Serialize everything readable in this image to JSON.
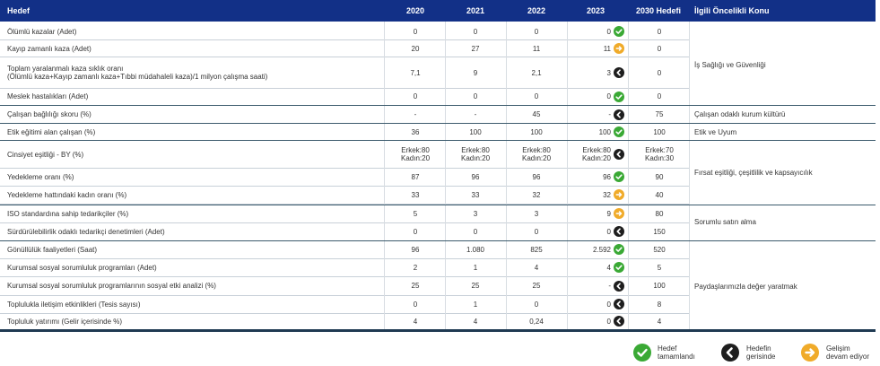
{
  "header": {
    "hedef": "Hedef",
    "y2020": "2020",
    "y2021": "2021",
    "y2022": "2022",
    "y2023": "2023",
    "target": "2030 Hedefi",
    "konu": "İlgili Öncelikli Konu"
  },
  "rows": [
    {
      "label": "Ölümlü kazalar (Adet)",
      "v2020": "0",
      "v2021": "0",
      "v2022": "0",
      "v2023": "0",
      "status": "green",
      "target": "0"
    },
    {
      "label": "Kayıp zamanlı kaza (Adet)",
      "v2020": "20",
      "v2021": "27",
      "v2022": "11",
      "v2023": "11",
      "status": "orange",
      "target": "0"
    },
    {
      "label": "Toplam yaralanmalı kaza sıklık oranı",
      "label2": "(Ölümlü kaza+Kayıp zamanlı kaza+Tıbbi müdahaleli kaza)/1 milyon çalışma saati)",
      "v2020": "7,1",
      "v2021": "9",
      "v2022": "2,1",
      "v2023": "3",
      "status": "black",
      "target": "0"
    },
    {
      "label": "Meslek hastalıkları (Adet)",
      "v2020": "0",
      "v2021": "0",
      "v2022": "0",
      "v2023": "0",
      "status": "green",
      "target": "0"
    },
    {
      "label": "Çalışan bağlılığı skoru (%)",
      "v2020": "-",
      "v2021": "-",
      "v2022": "45",
      "v2023": "-",
      "status": "black",
      "target": "75"
    },
    {
      "label": "Etik eğitimi alan çalışan (%)",
      "v2020": "36",
      "v2021": "100",
      "v2022": "100",
      "v2023": "100",
      "status": "green",
      "target": "100"
    },
    {
      "label": "Cinsiyet eşitliği - BY (%)",
      "v2020": "Erkek:80",
      "v2020b": "Kadın:20",
      "v2021": "Erkek:80",
      "v2021b": "Kadın:20",
      "v2022": "Erkek:80",
      "v2022b": "Kadın:20",
      "v2023": "Erkek:80",
      "v2023b": "Kadın:20",
      "status": "black",
      "target": "Erkek:70",
      "targetb": "Kadın:30"
    },
    {
      "label": "Yedekleme oranı (%)",
      "v2020": "87",
      "v2021": "96",
      "v2022": "96",
      "v2023": "96",
      "status": "green",
      "target": "90"
    },
    {
      "label": "Yedekleme hattındaki kadın oranı (%)",
      "v2020": "33",
      "v2021": "33",
      "v2022": "32",
      "v2023": "32",
      "status": "orange",
      "target": "40"
    },
    {
      "label": "ISO standardına sahip tedarikçiler (%)",
      "v2020": "5",
      "v2021": "3",
      "v2022": "3",
      "v2023": "9",
      "status": "orange",
      "target": "80"
    },
    {
      "label": "Sürdürülebilirlik odaklı tedarikçi denetimleri (Adet)",
      "v2020": "0",
      "v2021": "0",
      "v2022": "0",
      "v2023": "0",
      "status": "black",
      "target": "150"
    },
    {
      "label": "Gönüllülük faaliyetleri (Saat)",
      "v2020": "96",
      "v2021": "1.080",
      "v2022": "825",
      "v2023": "2.592",
      "status": "green",
      "target": "520"
    },
    {
      "label": "Kurumsal sosyal sorumluluk programları (Adet)",
      "v2020": "2",
      "v2021": "1",
      "v2022": "4",
      "v2023": "4",
      "status": "green",
      "target": "5"
    },
    {
      "label": "Kurumsal sosyal sorumluluk programlarının sosyal etki analizi (%)",
      "v2020": "25",
      "v2021": "25",
      "v2022": "25",
      "v2023": "-",
      "status": "black",
      "target": "100"
    },
    {
      "label": "Toplulukla iletişim etkinlikleri (Tesis sayısı)",
      "v2020": "0",
      "v2021": "1",
      "v2022": "0",
      "v2023": "0",
      "status": "black",
      "target": "8"
    },
    {
      "label": "Topluluk yatırımı (Gelir içerisinde %)",
      "v2020": "4",
      "v2021": "4",
      "v2022": "0,24",
      "v2023": "0",
      "status": "black",
      "target": "4"
    }
  ],
  "groups": {
    "isg": "İş Sağlığı ve Güvenliği",
    "calisan": "Çalışan odaklı kurum kültürü",
    "etik": "Etik ve Uyum",
    "firsat": "Fırsat eşitliği, çeşitlilik ve kapsayıcılık",
    "satin": "Sorumlu satın alma",
    "paydas": "Paydaşlarımızla değer yaratmak"
  },
  "legend": {
    "done_1": "Hedef",
    "done_2": "tamamlandı",
    "behind_1": "Hedefin",
    "behind_2": "gerisinde",
    "progress_1": "Gelişim",
    "progress_2": "devam ediyor"
  },
  "colors": {
    "header_bg": "#123087",
    "green": "#3aa935",
    "orange": "#f0ab2a",
    "black": "#1e1e1e"
  }
}
